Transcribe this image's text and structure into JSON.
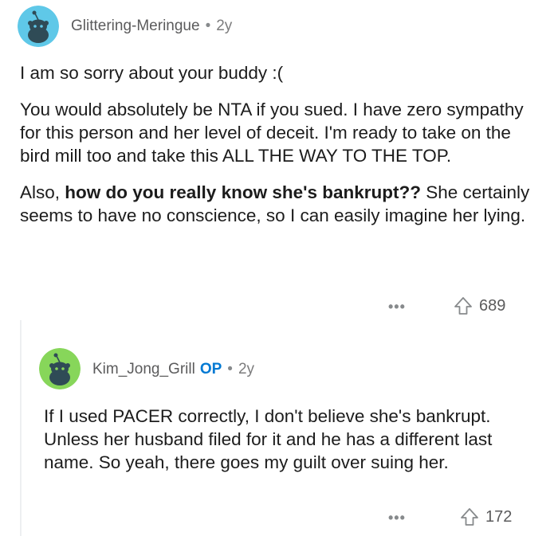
{
  "comments": [
    {
      "username": "Glittering-Meringue",
      "age": "2y",
      "paragraphs": [
        "I am so sorry about your buddy :(",
        "You would absolutely be NTA if you sued. I have zero sympathy for this person and her level of deceit. I'm ready to take on the bird mill too and take this ALL THE WAY TO THE TOP."
      ],
      "p3_prefix": "Also, ",
      "p3_bold": "how do you really know she's bankrupt??",
      "p3_rest": " She certainly seems to have no conscience, so I can easily imagine her lying.",
      "more": "•••",
      "upvotes": "689",
      "avatar_color": "#5fc8e8"
    },
    {
      "username": "Kim_Jong_Grill",
      "op_badge": "OP",
      "age": "2y",
      "paragraphs": [
        "If I used PACER correctly, I don't believe she's bankrupt. Unless her husband filed for it and he has a different last name. So yeah, there goes my guilt over suing her."
      ],
      "more": "•••",
      "upvotes": "172",
      "avatar_color": "#87d65a"
    }
  ],
  "separator": "•"
}
